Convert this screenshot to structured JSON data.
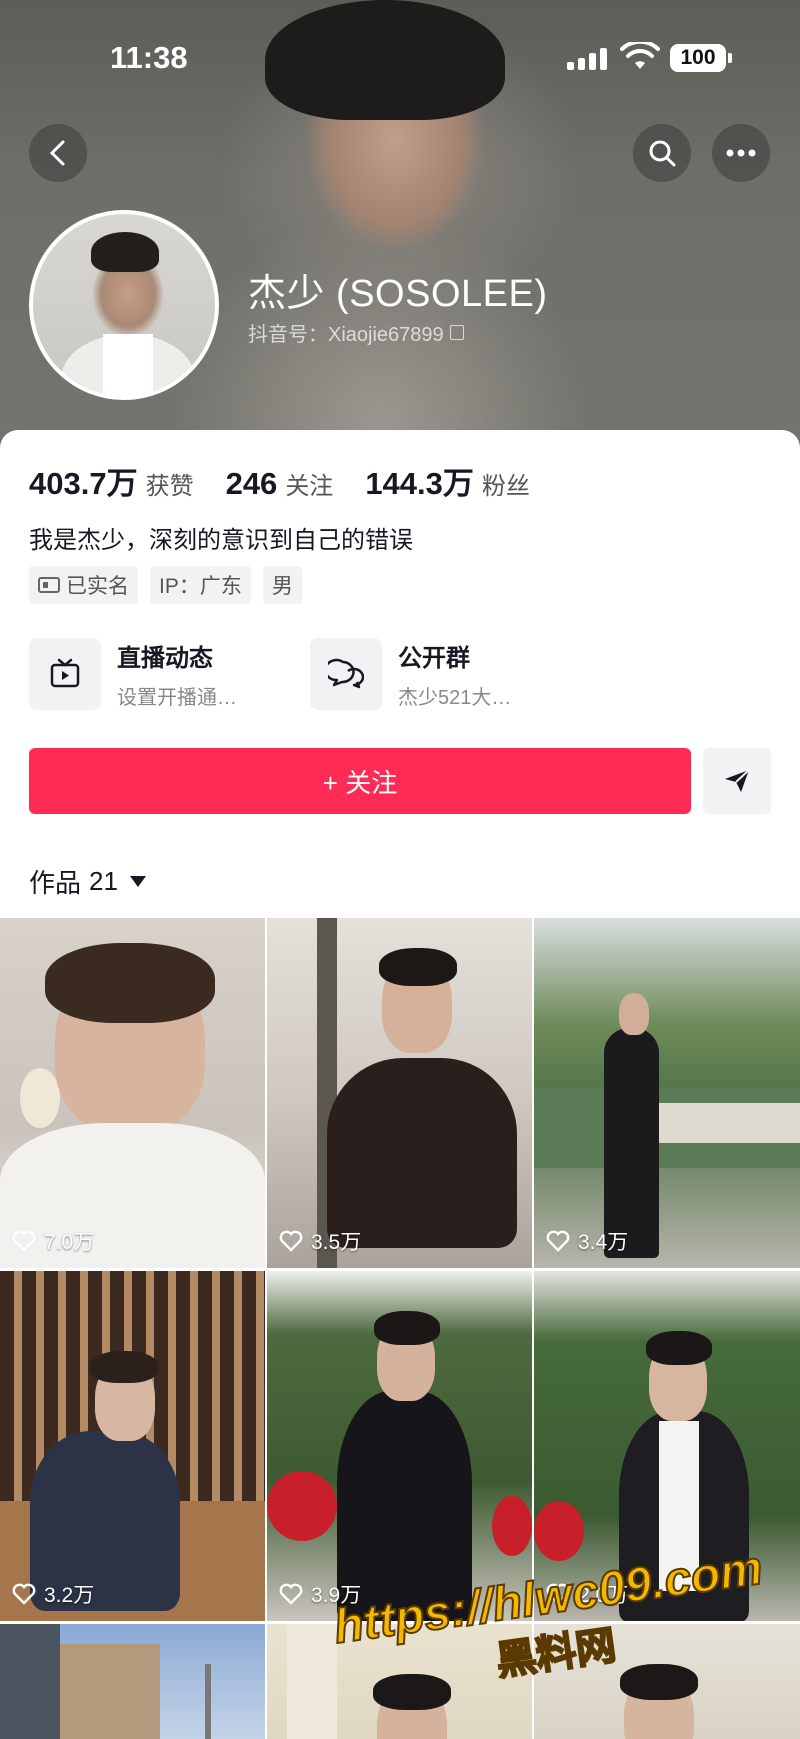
{
  "status": {
    "time": "11:38",
    "battery": "100"
  },
  "profile": {
    "name": "杰少 (SOSOLEE)",
    "douyin_id": "抖音号：Xiaojie67899",
    "bio": "我是杰少，深刻的意识到自己的错误"
  },
  "stats": [
    {
      "value": "403.7万",
      "label": "获赞"
    },
    {
      "value": "246",
      "label": "关注"
    },
    {
      "value": "144.3万",
      "label": "粉丝"
    }
  ],
  "tags": [
    "已实名",
    "IP：广东",
    "男"
  ],
  "features": [
    {
      "title": "直播动态",
      "subtitle": "设置开播通…",
      "icon": "tv-icon"
    },
    {
      "title": "公开群",
      "subtitle": "杰少521大…",
      "icon": "chat-bubbles-icon"
    }
  ],
  "actions": {
    "follow_label": "+ 关注"
  },
  "works": {
    "label": "作品",
    "count": "21"
  },
  "videos": [
    {
      "likes": "7.0万"
    },
    {
      "likes": "3.5万"
    },
    {
      "likes": "3.4万"
    },
    {
      "likes": "3.2万"
    },
    {
      "likes": "3.9万"
    },
    {
      "likes": "2.0万"
    },
    {
      "likes": ""
    },
    {
      "likes": ""
    },
    {
      "likes": ""
    }
  ],
  "watermark": {
    "url": "https://hlwc09.com",
    "name": "黑料网"
  },
  "colors": {
    "accent": "#fe2c55",
    "tag_bg": "#f2f2f4",
    "watermark": "#f5b800"
  }
}
